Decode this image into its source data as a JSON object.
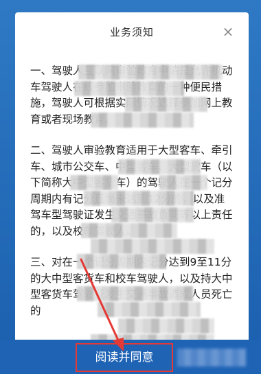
{
  "dialog": {
    "title": "业务须知",
    "close_symbol": "×",
    "paragraphs": [
      "一、驾驶人互联网审验教育申请是允许机动车驾驶人在线参加审验教育的一种便民措施，驾驶人可根据实际情况选择参加网上教育或者现场教育。",
      "二、驾驶人审验教育适用于大型客车、牵引车、城市公交车、中型客车、大型货车（以下简称大中型客货车）的驾驶人在一个记分周期内有记分且尚未达到12分的，以及准驾车型驾驶证发生交通事故负同等以上责任的，以及校车驾驶人。",
      "三、对在一个记分周期内记分达到9至11分的大中型客货车和校车驾驶人，以及持大中型客货车驾驶证发生交通事故造成人员死亡的"
    ]
  },
  "footer": {
    "agree_label": "阅读并同意"
  },
  "colors": {
    "accent": "#1f63b5",
    "highlight": "#e53935"
  }
}
